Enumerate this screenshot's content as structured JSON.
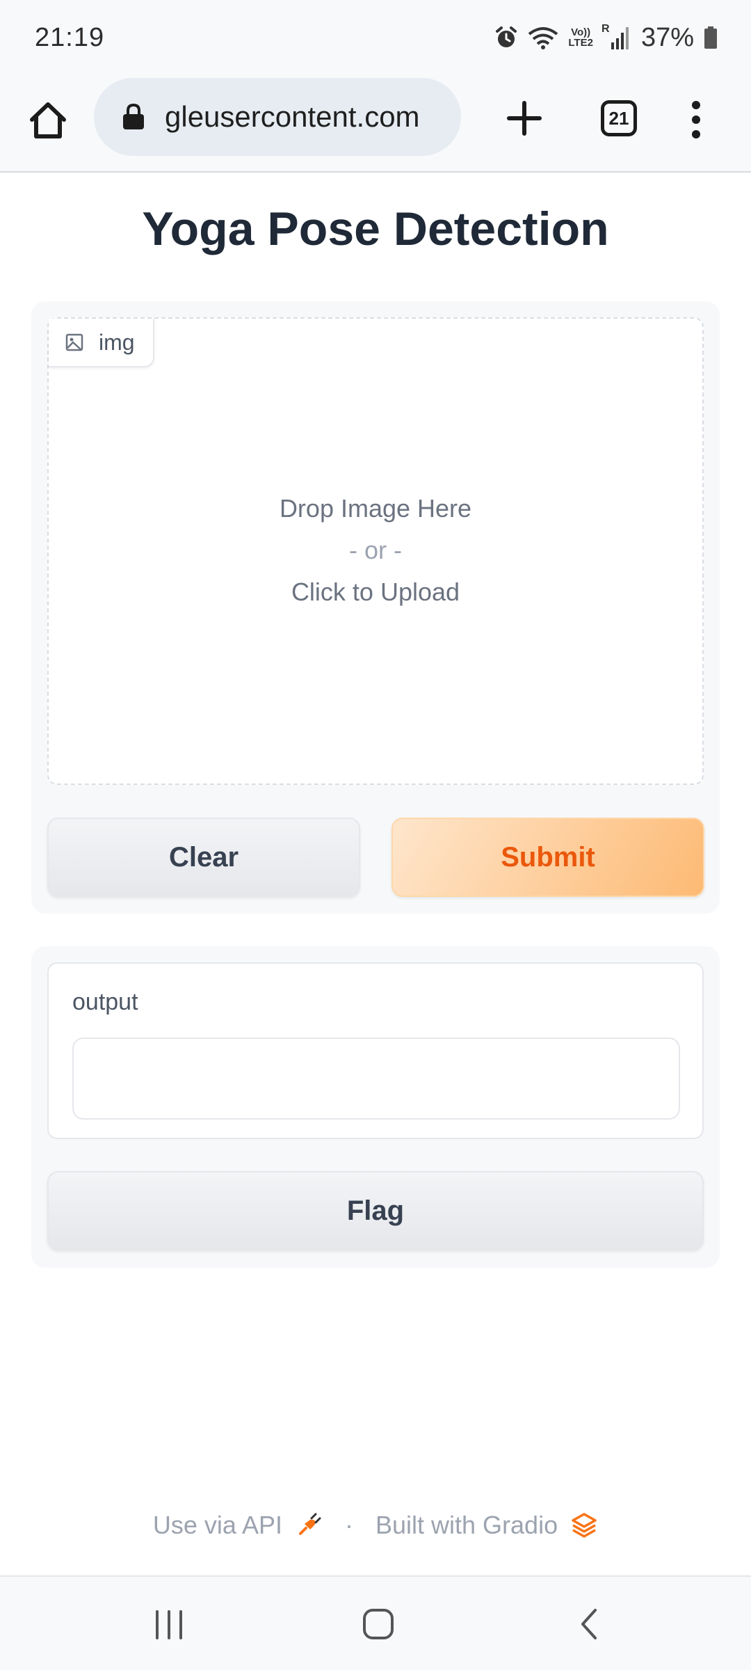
{
  "status_bar": {
    "time": "21:19",
    "battery": "37%",
    "icons": [
      "alarm-icon",
      "wifi-icon",
      "volte-lte2-icon",
      "signal-icon",
      "battery-icon"
    ],
    "network_label_top": "Vo))",
    "network_label_bottom": "LTE2",
    "roaming_label": "R"
  },
  "browser": {
    "url": "gleusercontent.com",
    "tab_count": "21",
    "icons": [
      "home-icon",
      "lock-icon",
      "plus-icon",
      "tabs-icon",
      "more-vert-icon"
    ]
  },
  "page": {
    "title": "Yoga Pose Detection"
  },
  "input_panel": {
    "image_label": "img",
    "drop_line1": "Drop Image Here",
    "drop_line2": "- or -",
    "drop_line3": "Click to Upload",
    "clear_label": "Clear",
    "submit_label": "Submit"
  },
  "output_panel": {
    "label": "output",
    "value": "",
    "flag_label": "Flag"
  },
  "footer": {
    "api_text": "Use via API",
    "separator": "·",
    "built_text": "Built with Gradio"
  },
  "colors": {
    "accent": "#ea580c",
    "submit_bg_start": "#fee6cc",
    "submit_bg_end": "#fdba74",
    "title": "#1f2937",
    "muted": "#9ca3af"
  }
}
